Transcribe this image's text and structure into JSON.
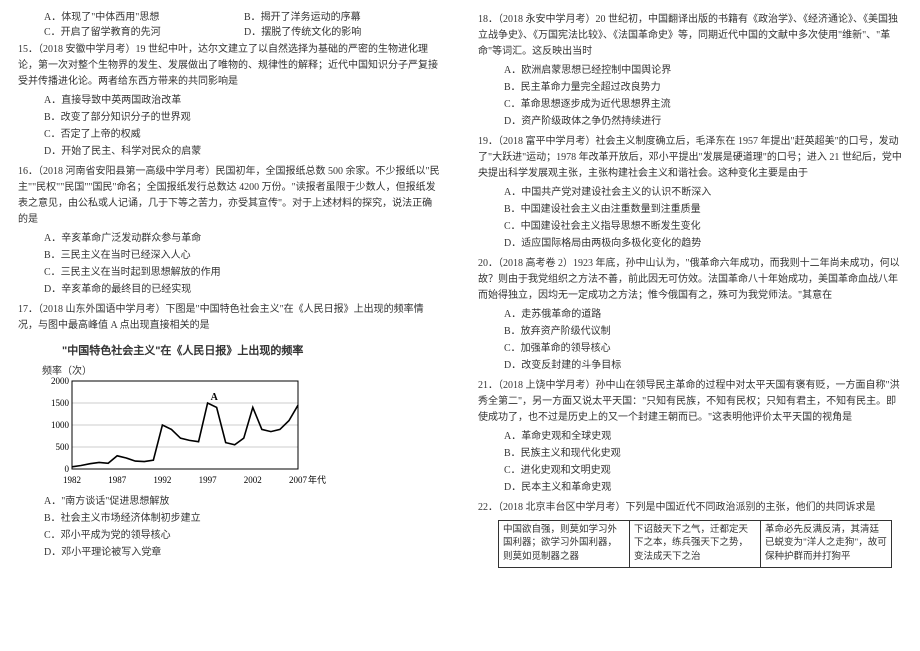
{
  "left": {
    "q14": {
      "optA": "A．体现了\"中体西用\"思想",
      "optB": "B．揭开了洋务运动的序幕",
      "optC": "C．开启了留学教育的先河",
      "optD": "D．摆脱了传统文化的影响"
    },
    "q15": {
      "stem": "15．（2018 安徽中学月考）19 世纪中叶，达尔文建立了以自然选择为基础的严密的生物进化理论，第一次对整个生物界的发生、发展做出了唯物的、规律性的解释；近代中国知识分子严复接受并传播进化论。两者给东西方带来的共同影响是",
      "optA": "A．直接导致中英两国政治改革",
      "optB": "B．改变了部分知识分子的世界观",
      "optC": "C．否定了上帝的权威",
      "optD": "D．开始了民主、科学对民众的启蒙"
    },
    "q16": {
      "stem": "16．（2018 河南省安阳县第一高级中学月考）民国初年，全国报纸总数 500 余家。不少报纸以\"民主\"\"民权\"\"民国\"\"国民\"命名；全国报纸发行总数达 4200 万份。\"读报者虽限于少数人，但报纸发表之意见，由公私或人记诵，几于下等之苦力，亦受其宣传\"。对于上述材料的探究，说法正确的是",
      "optA": "A．辛亥革命广泛发动群众参与革命",
      "optB": "B．三民主义在当时已经深入人心",
      "optC": "C．三民主义在当时起到思想解放的作用",
      "optD": "D．辛亥革命的最终目的已经实现"
    },
    "q17": {
      "stem": "17．（2018 山东外国语中学月考）下图是\"中国特色社会主义\"在《人民日报》上出现的频率情况，与图中最高峰值 A 点出现直接相关的是",
      "optA": "A．\"南方谈话\"促进思想解放",
      "optB": "B．社会主义市场经济体制初步建立",
      "optC": "C．邓小平成为党的领导核心",
      "optD": "D．邓小平理论被写入党章"
    }
  },
  "right": {
    "q18": {
      "stem": "18．（2018 永安中学月考）20 世纪初，中国翻译出版的书籍有《政治学》、《经济通论》、《美国独立战争史》、《万国宪法比较》、《法国革命史》等，同期近代中国的文献中多次使用\"维新\"、\"革命\"等词汇。这反映出当时",
      "optA": "A．欧洲启蒙思想已经控制中国舆论界",
      "optB": "B．民主革命力量完全超过改良势力",
      "optC": "C．革命思想逐步成为近代思想界主流",
      "optD": "D．资产阶级政体之争仍然持续进行"
    },
    "q19": {
      "stem": "19．（2018 富平中学月考）社会主义制度确立后，毛泽东在 1957 年提出\"赶英超美\"的口号，发动了\"大跃进\"运动；1978 年改革开放后，邓小平提出\"发展是硬道理\"的口号；进入 21 世纪后，党中央提出科学发展观主张，主张构建社会主义和谐社会。这种变化主要是由于",
      "optA": "A．中国共产党对建设社会主义的认识不断深入",
      "optB": "B．中国建设社会主义由注重数量到注重质量",
      "optC": "C．中国建设社会主义指导思想不断发生变化",
      "optD": "D．适应国际格局由两极向多极化变化的趋势"
    },
    "q20": {
      "stem": "20．（2018 高考卷 2）1923 年底，孙中山认为，\"俄革命六年成功，而我则十二年尚未成功，何以故？则由于我党组织之方法不善，前此因无可仿效。法国革命八十年始成功，美国革命血战八年而始得独立，因均无一定成功之方法；惟今俄国有之，殊可为我党师法。\"其意在",
      "optA": "A．走苏俄革命的道路",
      "optB": "B．放弃资产阶级代议制",
      "optC": "C．加强革命的领导核心",
      "optD": "D．改变反封建的斗争目标"
    },
    "q21": {
      "stem": "21．（2018 上饶中学月考）孙中山在领导民主革命的过程中对太平天国有褒有贬，一方面自称\"洪秀全第二\"，另一方面又说太平天国：\"只知有民族，不知有民权；只知有君主，不知有民主。即使成功了，也不过是历史上的又一个封建王朝而已。\"这表明他评价太平天国的视角是",
      "optA": "A．革命史观和全球史观",
      "optB": "B．民族主义和现代化史观",
      "optC": "C．进化史观和文明史观",
      "optD": "D．民本主义和革命史观"
    },
    "q22": {
      "stem": "22．（2018 北京丰台区中学月考）下列是中国近代不同政治派别的主张，他们的共同诉求是",
      "table": [
        "中国欲自强，则莫如学习外国利器；欲学习外国利器，则莫如觅制器之器",
        "下诏鼓天下之气，迁都定天下之本，练兵强天下之势，变法成天下之治",
        "革命必先反满反清，其清廷已蜕变为\"洋人之走狗\"，故可保种护群而并打狗平"
      ]
    }
  },
  "chart_data": {
    "type": "line",
    "title": "\"中国特色社会主义\"在《人民日报》上出现的频率",
    "ylabel": "频率（次）",
    "xlabel": "年代",
    "x": [
      1982,
      1983,
      1984,
      1985,
      1986,
      1987,
      1988,
      1989,
      1990,
      1991,
      1992,
      1993,
      1994,
      1995,
      1996,
      1997,
      1998,
      1999,
      2000,
      2001,
      2002,
      2003,
      2004,
      2005,
      2006,
      2007
    ],
    "y": [
      50,
      80,
      120,
      150,
      130,
      300,
      250,
      180,
      170,
      200,
      1000,
      900,
      700,
      650,
      620,
      1500,
      1400,
      600,
      550,
      700,
      1400,
      900,
      850,
      900,
      1100,
      1450
    ],
    "yticks": [
      0,
      500,
      1000,
      1500,
      2000
    ],
    "xticks": [
      1982,
      1987,
      1992,
      1997,
      2002,
      2007
    ],
    "annotation": {
      "label": "A",
      "x": 1997,
      "y": 1500
    }
  }
}
